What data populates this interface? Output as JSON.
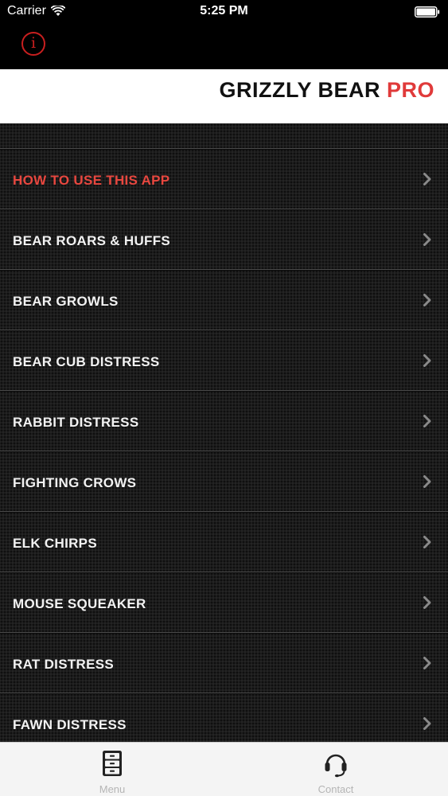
{
  "status_bar": {
    "carrier": "Carrier",
    "time": "5:25 PM"
  },
  "nav": {
    "info_glyph": "i"
  },
  "banner": {
    "title_main": "GRIZZLY BEAR ",
    "title_accent": "PRO",
    "accent_color": "#e03a3a"
  },
  "menu": {
    "items": [
      {
        "label": "HOW TO USE THIS APP",
        "highlight": true
      },
      {
        "label": "BEAR ROARS & HUFFS",
        "highlight": false
      },
      {
        "label": "BEAR GROWLS",
        "highlight": false
      },
      {
        "label": "BEAR CUB DISTRESS",
        "highlight": false
      },
      {
        "label": "RABBIT DISTRESS",
        "highlight": false
      },
      {
        "label": "FIGHTING CROWS",
        "highlight": false
      },
      {
        "label": "ELK CHIRPS",
        "highlight": false
      },
      {
        "label": "MOUSE SQUEAKER",
        "highlight": false
      },
      {
        "label": "RAT DISTRESS",
        "highlight": false
      },
      {
        "label": "FAWN DISTRESS",
        "highlight": false
      }
    ]
  },
  "tab_bar": {
    "tabs": [
      {
        "label": "Menu",
        "icon": "file-cabinet-icon"
      },
      {
        "label": "Contact",
        "icon": "headset-icon"
      }
    ]
  }
}
